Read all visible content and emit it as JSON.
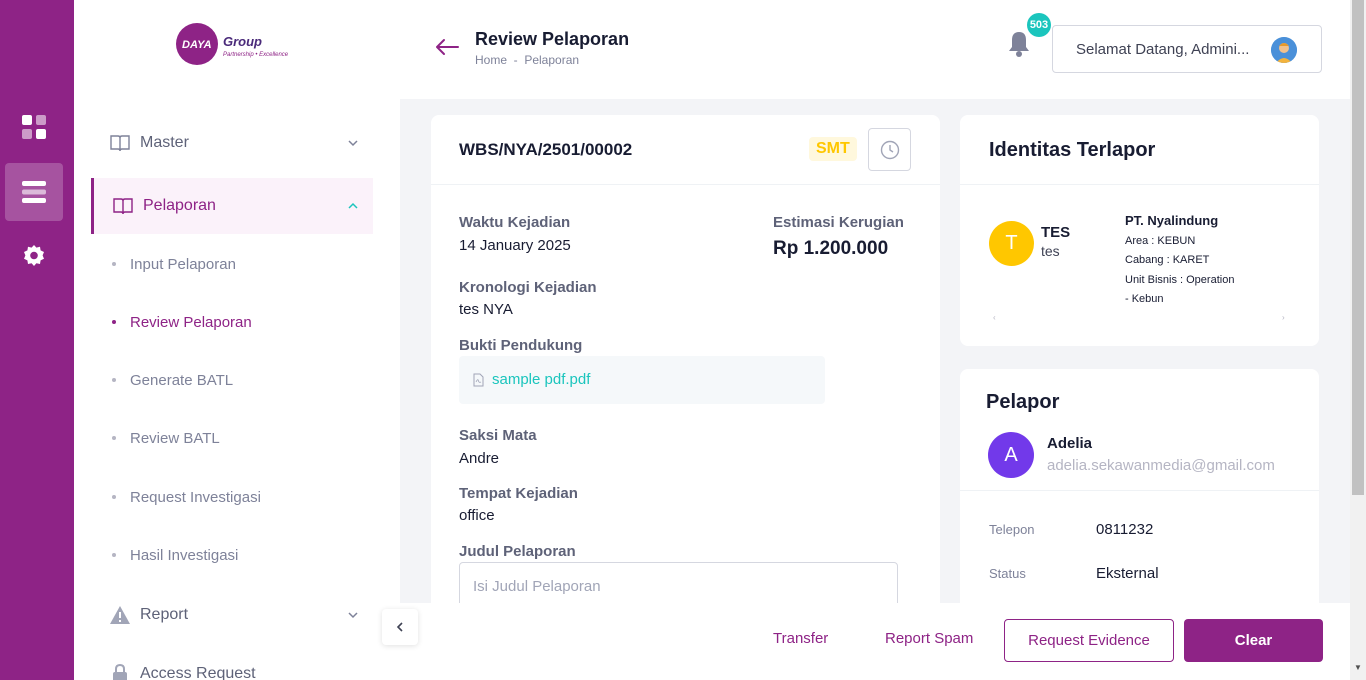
{
  "brand": {
    "logo_text": "DAYA Group",
    "logo_tagline": "Partnership • Excellence",
    "primary_color": "#8e2386",
    "accent_color": "#1bc5bd"
  },
  "rail": {
    "items": [
      {
        "icon": "dashboard-grid-icon"
      },
      {
        "icon": "menu-list-icon",
        "active": true
      },
      {
        "icon": "settings-gear-icon"
      }
    ]
  },
  "sidebar": {
    "menu": [
      {
        "label": "Master",
        "icon": "book-icon",
        "expanded": false
      },
      {
        "label": "Pelaporan",
        "icon": "book-open-icon",
        "expanded": true
      },
      {
        "label": "Report",
        "icon": "warning-triangle-icon",
        "expanded": false
      },
      {
        "label": "Access Request",
        "icon": "lock-icon",
        "expanded": false
      }
    ],
    "sub_items": [
      "Input Pelaporan",
      "Review Pelaporan",
      "Generate BATL",
      "Review BATL",
      "Request Investigasi",
      "Hasil Investigasi"
    ]
  },
  "header": {
    "title": "Review Pelaporan",
    "breadcrumb": "Home  -  Pelaporan",
    "notification_count": "503",
    "greeting": "Selamat Datang, Admini..."
  },
  "report": {
    "number": "WBS/NYA/2501/00002",
    "status_badge": "SMT",
    "fields": {
      "waktu_label": "Waktu Kejadian",
      "waktu_value": "14 January 2025",
      "estimasi_label": "Estimasi Kerugian",
      "estimasi_value": "Rp 1.200.000",
      "kronologi_label": "Kronologi Kejadian",
      "kronologi_value": "tes NYA",
      "bukti_label": "Bukti Pendukung",
      "bukti_file": "sample pdf.pdf",
      "saksi_label": "Saksi Mata",
      "saksi_value": "Andre",
      "tempat_label": "Tempat Kejadian",
      "tempat_value": "office",
      "judul_label": "Judul Pelaporan",
      "judul_placeholder": "Isi Judul Pelaporan"
    }
  },
  "terlapor": {
    "title": "Identitas Terlapor",
    "initial": "T",
    "name": "TES",
    "sub": "tes",
    "company": "PT. Nyalindung",
    "area": "Area : KEBUN",
    "cabang": "Cabang : KARET",
    "unit_line1": "Unit Bisnis : Operation",
    "unit_line2": "- Kebun"
  },
  "pelapor": {
    "title": "Pelapor",
    "initial": "A",
    "name": "Adelia",
    "email": "adelia.sekawanmedia@gmail.com",
    "telepon_label": "Telepon",
    "telepon_value": "0811232",
    "status_label": "Status",
    "status_value": "Eksternal"
  },
  "actions": {
    "transfer": "Transfer",
    "report_spam": "Report Spam",
    "request_evidence": "Request Evidence",
    "clear": "Clear"
  }
}
